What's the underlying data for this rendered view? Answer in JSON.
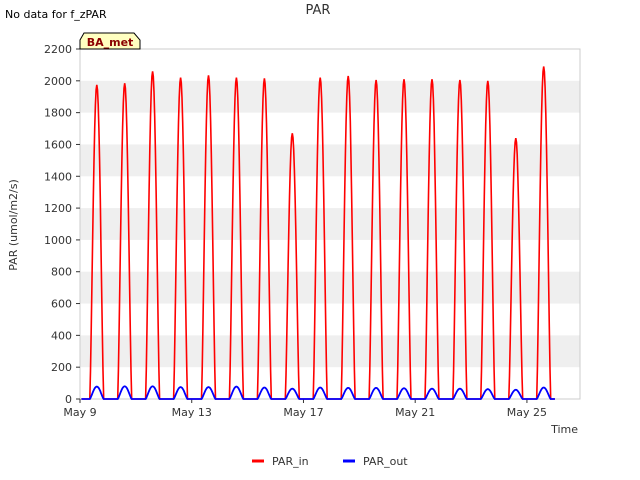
{
  "page": {
    "no_data_note": "No data for f_zPAR"
  },
  "chart_data": {
    "type": "line",
    "title": "PAR",
    "xlabel": "Time",
    "ylabel": "PAR (umol/m2/s)",
    "ylim": [
      0,
      2200
    ],
    "yticks": [
      0,
      200,
      400,
      600,
      800,
      1000,
      1200,
      1400,
      1600,
      1800,
      2000,
      2200
    ],
    "xlim_days": [
      9,
      26.9
    ],
    "xticks": [
      {
        "label": "May 9",
        "day": 9
      },
      {
        "label": "May 13",
        "day": 13
      },
      {
        "label": "May 17",
        "day": 17
      },
      {
        "label": "May 21",
        "day": 21
      },
      {
        "label": "May 25",
        "day": 25
      }
    ],
    "grid": "horizontal-bands",
    "legend_position": "bottom-center",
    "site_label": "BA_met",
    "colors": {
      "PAR_in": "#ff0000",
      "PAR_out": "#0000ff",
      "band": "#efefef",
      "site_label_bg": "#ffffc0",
      "site_label_text": "#8b0000"
    },
    "series": [
      {
        "name": "PAR_in",
        "peak_day": [
          9.6,
          10.6,
          11.6,
          12.6,
          13.6,
          14.6,
          15.6,
          16.6,
          17.6,
          18.6,
          19.6,
          20.6,
          21.6,
          22.6,
          23.6,
          24.6,
          25.6
        ],
        "peak_value": [
          1975,
          1985,
          2060,
          2020,
          2035,
          2020,
          2015,
          1670,
          2020,
          2030,
          2005,
          2010,
          2010,
          2005,
          2000,
          1640,
          2090
        ]
      },
      {
        "name": "PAR_out",
        "peak_day": [
          9.6,
          10.6,
          11.6,
          12.6,
          13.6,
          14.6,
          15.6,
          16.6,
          17.6,
          18.6,
          19.6,
          20.6,
          21.6,
          22.6,
          23.6,
          24.6,
          25.6
        ],
        "peak_value": [
          78,
          80,
          80,
          75,
          75,
          78,
          72,
          65,
          72,
          70,
          70,
          68,
          65,
          65,
          62,
          58,
          72
        ]
      }
    ]
  }
}
